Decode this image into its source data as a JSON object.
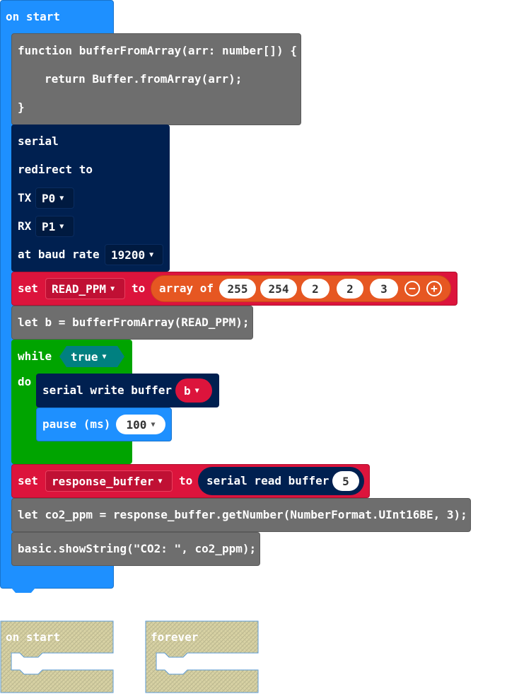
{
  "on_start": {
    "header": "on start",
    "function_block": {
      "line1": "function bufferFromArray(arr: number[]) {",
      "line2": "return Buffer.fromArray(arr);",
      "line3": "}"
    },
    "serial_redirect": {
      "title": "serial",
      "redirect_label": "redirect to",
      "tx_label": "TX",
      "tx_value": "P0",
      "rx_label": "RX",
      "rx_value": "P1",
      "baud_label": "at baud rate",
      "baud_value": "19200"
    },
    "set_read_ppm": {
      "set_label": "set",
      "variable": "READ_PPM",
      "to_label": "to",
      "array_label": "array of",
      "values": [
        "255",
        "254",
        "2",
        "2",
        "3"
      ]
    },
    "let_b": "let b = bufferFromArray(READ_PPM);",
    "while_block": {
      "while_label": "while",
      "condition": "true",
      "do_label": "do",
      "write_label": "serial write buffer",
      "write_var": "b",
      "pause_label": "pause (ms)",
      "pause_value": "100"
    },
    "set_response": {
      "set_label": "set",
      "variable": "response_buffer",
      "to_label": "to",
      "read_label": "serial read buffer",
      "read_value": "5"
    },
    "let_co2": "let co2_ppm = response_buffer.getNumber(NumberFormat.UInt16BE, 3);",
    "show_string": "basic.showString(\"CO2: \", co2_ppm);"
  },
  "ghost_blocks": {
    "on_start": "on start",
    "forever": "forever"
  },
  "colors": {
    "events": "#1e90ff",
    "javascript": "#6e6e6e",
    "serial": "#002050",
    "variables": "#dc143c",
    "arrays": "#e65722",
    "loops": "#00a400",
    "logic": "#008080",
    "basic": "#1e90ff"
  },
  "icons": [
    "dropdown-caret-icon",
    "remove-circle-icon",
    "add-circle-icon"
  ]
}
